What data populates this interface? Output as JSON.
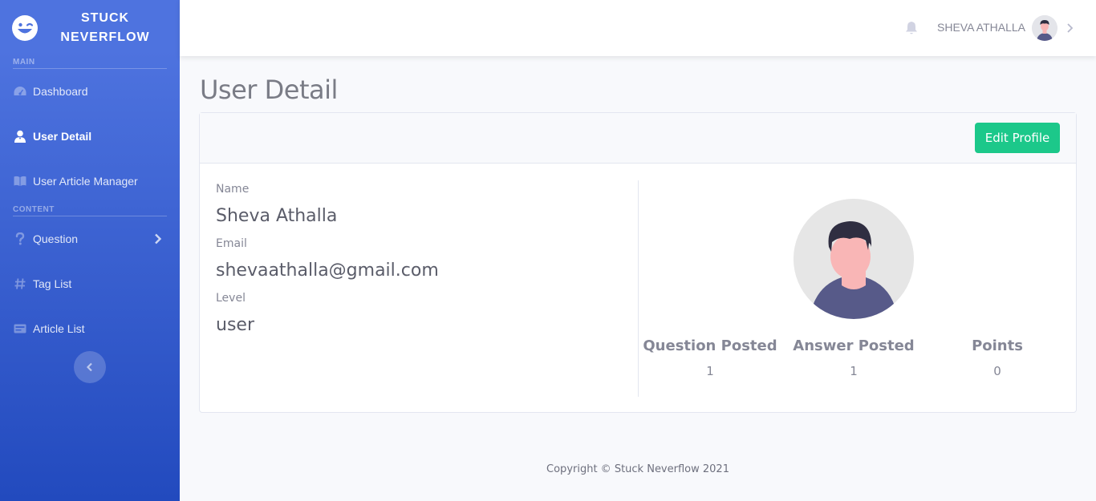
{
  "brand": {
    "name": "STUCK\nNEVERFLOW"
  },
  "sidebar": {
    "headings": {
      "main": "MAIN",
      "content": "CONTENT"
    },
    "items": [
      {
        "label": "Dashboard",
        "icon": "dashboard-icon",
        "active": false
      },
      {
        "label": "User Detail",
        "icon": "user-icon",
        "active": true
      },
      {
        "label": "User Article Manager",
        "icon": "book-icon",
        "active": false
      },
      {
        "label": "Question",
        "icon": "question-icon",
        "active": false,
        "has_submenu": true
      },
      {
        "label": "Tag List",
        "icon": "hashtag-icon",
        "active": false
      },
      {
        "label": "Article List",
        "icon": "newspaper-icon",
        "active": false
      }
    ],
    "toggle_icon": "chevron-left-icon"
  },
  "topbar": {
    "username": "SHEVA ATHALLA",
    "bell_icon": "bell-icon"
  },
  "page": {
    "title": "User Detail"
  },
  "card": {
    "edit_button": "Edit Profile",
    "fields": [
      {
        "label": "Name",
        "value": "Sheva Athalla"
      },
      {
        "label": "Email",
        "value": "shevaathalla@gmail.com"
      },
      {
        "label": "Level",
        "value": "user"
      }
    ],
    "stats": [
      {
        "title": "Question Posted",
        "value": "1"
      },
      {
        "title": "Answer Posted",
        "value": "1"
      },
      {
        "title": "Points",
        "value": "0"
      }
    ]
  },
  "footer": {
    "text": "Copyright © Stuck Neverflow 2021"
  },
  "colors": {
    "primary": "#4e73df",
    "success": "#1cc88a",
    "text_muted": "#858796"
  }
}
